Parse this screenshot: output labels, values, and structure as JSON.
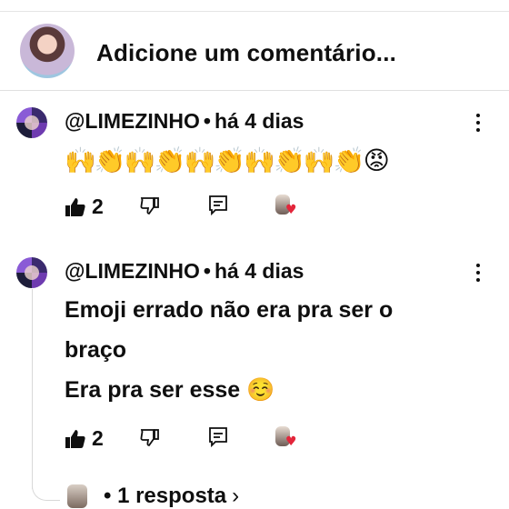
{
  "compose": {
    "prompt": "Adicione um comentário..."
  },
  "comments": [
    {
      "author": "@LIMEZINHO",
      "separator": "•",
      "time": "há 4 dias",
      "emojis": "🙌👏🙌👏🙌👏🙌👏🙌👏😡",
      "likes": "2",
      "icons": {
        "like": "thumbs-up-icon",
        "dislike": "thumbs-down-icon",
        "reply": "reply-icon",
        "creator_heart": "creator-heart-icon",
        "menu": "more-vert-icon"
      }
    },
    {
      "author": "@LIMEZINHO",
      "separator": "•",
      "time": "há 4 dias",
      "text": "Emoji errado não era pra ser o\nbraço\nEra pra ser esse ☺️",
      "likes": "2",
      "replies_label": "• 1 resposta",
      "replies_chevron": "›"
    }
  ],
  "colors": {
    "text": "#0f0f0f",
    "heart": "#e3263b",
    "divider": "#e0e0e0"
  }
}
